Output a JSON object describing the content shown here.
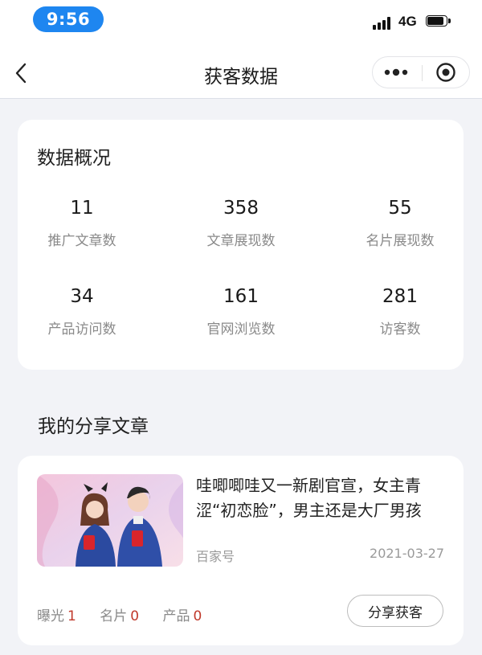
{
  "status_bar": {
    "time": "9:56",
    "network": "4G"
  },
  "nav": {
    "title": "获客数据",
    "back_icon": "chevron-left-icon",
    "more_icon": "more-dots-icon",
    "close_icon": "target-close-icon"
  },
  "overview": {
    "title": "数据概况",
    "stats": [
      {
        "value": "11",
        "label": "推广文章数"
      },
      {
        "value": "358",
        "label": "文章展现数"
      },
      {
        "value": "55",
        "label": "名片展现数"
      },
      {
        "value": "34",
        "label": "产品访问数"
      },
      {
        "value": "161",
        "label": "官网浏览数"
      },
      {
        "value": "281",
        "label": "访客数"
      }
    ]
  },
  "articles": {
    "section_title": "我的分享文章",
    "items": [
      {
        "title": "哇唧唧哇又一新剧官宣，女主青涩“初恋脸”，男主还是大厂男孩",
        "source": "百家号",
        "date": "2021-03-27",
        "metrics": [
          {
            "label": "曝光",
            "value": "1"
          },
          {
            "label": "名片",
            "value": "0"
          },
          {
            "label": "产品",
            "value": "0"
          }
        ],
        "share_label": "分享获客"
      }
    ]
  },
  "colors": {
    "accent": "#1e86f0",
    "metric_value": "#c0392b",
    "background": "#f2f3f7"
  }
}
